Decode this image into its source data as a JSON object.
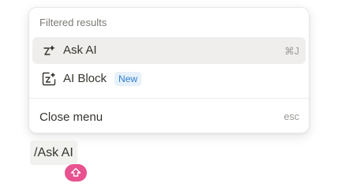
{
  "menu": {
    "header": "Filtered results",
    "items": [
      {
        "label": "Ask AI",
        "shortcut": "⌘J",
        "icon": "ai-sparkle-icon",
        "selected": true
      },
      {
        "label": "AI Block",
        "badge": "New",
        "icon": "ai-block-icon",
        "selected": false
      }
    ],
    "close": {
      "label": "Close menu",
      "shortcut": "esc"
    }
  },
  "editor": {
    "slash_text": "/Ask AI",
    "cursor_icon": "shift-arrow-icon",
    "cursor_color": "#e8528e"
  },
  "colors": {
    "selected_bg": "#efeeec",
    "badge_bg": "#e7f1fb",
    "badge_text": "#2f7ed0"
  }
}
